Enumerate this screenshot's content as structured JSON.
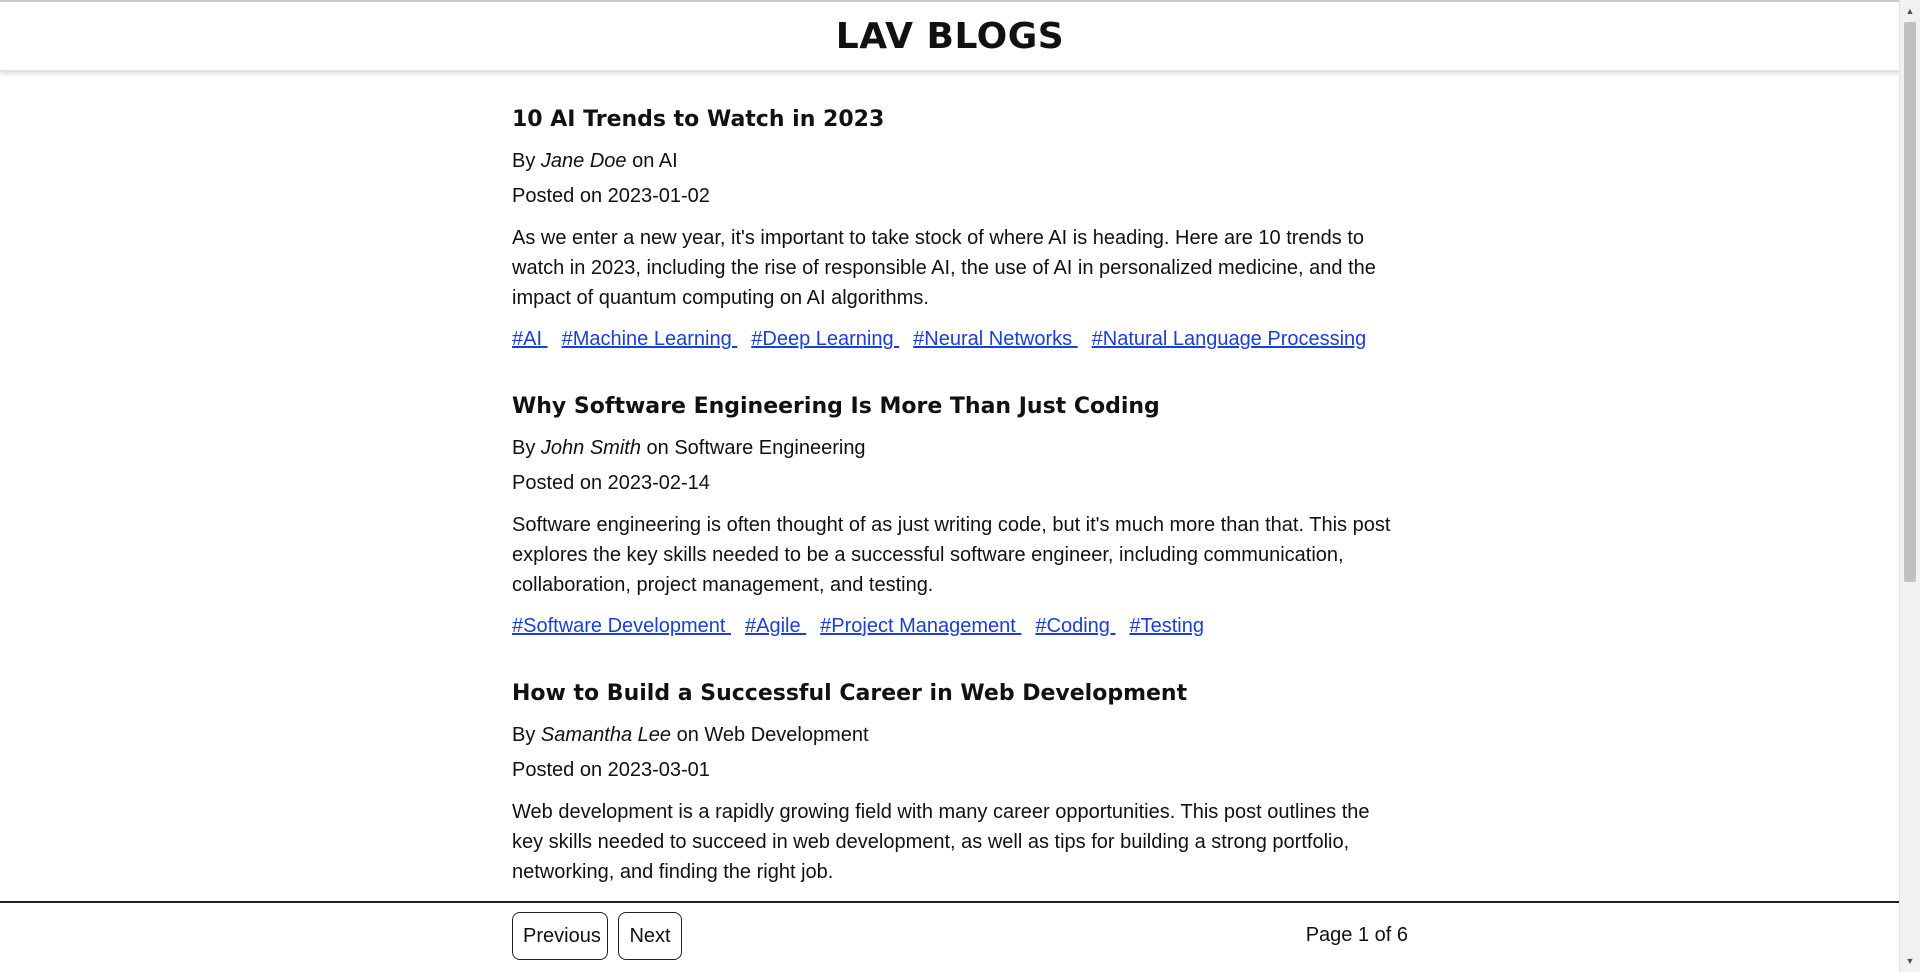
{
  "site": {
    "title": "LAV BLOGS"
  },
  "posts": [
    {
      "title": "10 AI Trends to Watch in 2023",
      "by_label": "By ",
      "author": "Jane Doe",
      "on_label": " on ",
      "category": "AI",
      "date_label": "Posted on ",
      "date": "2023-01-02",
      "body": "As we enter a new year, it's important to take stock of where AI is heading. Here are 10 trends to watch in 2023, including the rise of responsible AI, the use of AI in personalized medicine, and the impact of quantum computing on AI algorithms.",
      "tags": [
        "#AI ",
        "#Machine Learning ",
        "#Deep Learning ",
        "#Neural Networks ",
        "#Natural Language Processing"
      ]
    },
    {
      "title": "Why Software Engineering Is More Than Just Coding",
      "by_label": "By ",
      "author": "John Smith",
      "on_label": " on ",
      "category": "Software Engineering",
      "date_label": "Posted on ",
      "date": "2023-02-14",
      "body": "Software engineering is often thought of as just writing code, but it's much more than that. This post explores the key skills needed to be a successful software engineer, including communication, collaboration, project management, and testing.",
      "tags": [
        "#Software Development ",
        "#Agile ",
        "#Project Management ",
        "#Coding ",
        "#Testing"
      ]
    },
    {
      "title": "How to Build a Successful Career in Web Development",
      "by_label": "By ",
      "author": "Samantha Lee",
      "on_label": " on ",
      "category": "Web Development",
      "date_label": "Posted on ",
      "date": "2023-03-01",
      "body": "Web development is a rapidly growing field with many career opportunities. This post outlines the key skills needed to succeed in web development, as well as tips for building a strong portfolio, networking, and finding the right job.",
      "tags": []
    }
  ],
  "pagination": {
    "previous_label": "Previous",
    "next_label": "Next",
    "page_info": "Page 1 of 6"
  },
  "colors": {
    "link": "#1a3fd6",
    "text": "#111111",
    "background": "#ffffff"
  }
}
